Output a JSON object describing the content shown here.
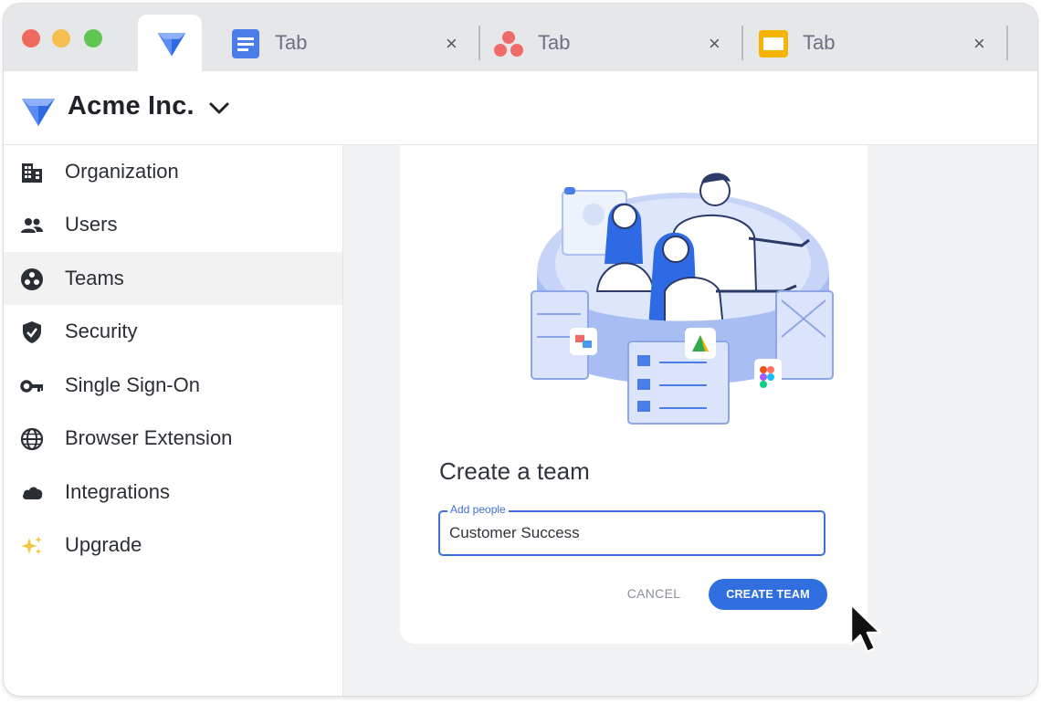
{
  "window": {
    "traffic_lights": [
      "#ee6a5f",
      "#f5be4f",
      "#61c554"
    ]
  },
  "tabs": [
    {
      "label": "Tab",
      "close": "×",
      "icon": "google-docs-icon"
    },
    {
      "label": "Tab",
      "close": "×",
      "icon": "asana-icon"
    },
    {
      "label": "Tab",
      "close": "×",
      "icon": "google-slides-icon"
    }
  ],
  "header": {
    "org_name": "Acme Inc.",
    "logo_icon": "acme-diamond-logo",
    "dropdown_icon": "chevron-down-icon"
  },
  "sidebar": {
    "items": [
      {
        "label": "Organization",
        "icon": "building-icon"
      },
      {
        "label": "Users",
        "icon": "users-icon"
      },
      {
        "label": "Teams",
        "icon": "teams-icon",
        "active": true
      },
      {
        "label": "Security",
        "icon": "shield-icon"
      },
      {
        "label": "Single Sign-On",
        "icon": "key-icon"
      },
      {
        "label": "Browser Extension",
        "icon": "globe-icon"
      },
      {
        "label": "Integrations",
        "icon": "cloud-icon"
      },
      {
        "label": "Upgrade",
        "icon": "sparkles-icon"
      }
    ]
  },
  "dialog": {
    "title": "Create a team",
    "field_label": "Add people",
    "field_value": "Customer Success",
    "cancel_label": "CANCEL",
    "create_label": "CREATE TEAM"
  },
  "colors": {
    "accent": "#2f6fe0",
    "logo_blue": "#2d6ae3",
    "sidebar_active": "#f2f2f3",
    "content_bg": "#f1f2f4"
  }
}
